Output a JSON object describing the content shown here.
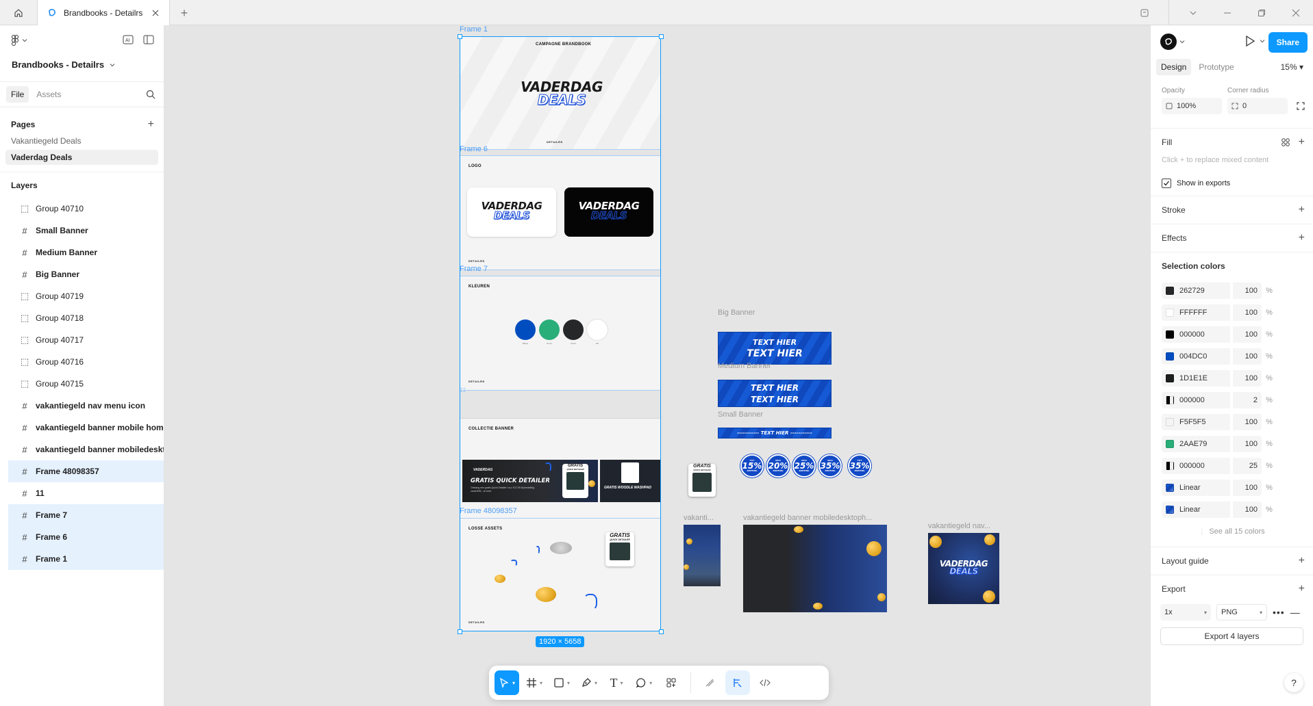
{
  "tabbar": {
    "tab_title": "Brandbooks - Detailrs",
    "new_tab_icon": "plus-icon"
  },
  "file": {
    "title": "Brandbooks - Detailrs"
  },
  "left_panel": {
    "tabs": [
      "File",
      "Assets"
    ],
    "pages_header": "Pages",
    "pages": [
      "Vakantiegeld Deals",
      "Vaderdag Deals"
    ],
    "layers_header": "Layers",
    "layers": [
      {
        "name": "Group 40710",
        "type": "group"
      },
      {
        "name": "Small Banner",
        "type": "frame"
      },
      {
        "name": "Medium Banner",
        "type": "frame"
      },
      {
        "name": "Big Banner",
        "type": "frame"
      },
      {
        "name": "Group 40719",
        "type": "group"
      },
      {
        "name": "Group 40718",
        "type": "group"
      },
      {
        "name": "Group 40717",
        "type": "group"
      },
      {
        "name": "Group 40716",
        "type": "group"
      },
      {
        "name": "Group 40715",
        "type": "group"
      },
      {
        "name": "vakantiegeld nav menu icon",
        "type": "frame"
      },
      {
        "name": "vakantiegeld banner mobile home",
        "type": "frame"
      },
      {
        "name": "vakantiegeld banner mobiledesktophome",
        "type": "frame"
      },
      {
        "name": "Frame 48098357",
        "type": "frame",
        "selected": true
      },
      {
        "name": "11",
        "type": "frame"
      },
      {
        "name": "Frame 7",
        "type": "frame",
        "selected": true
      },
      {
        "name": "Frame 6",
        "type": "frame",
        "selected": true
      },
      {
        "name": "Frame 1",
        "type": "frame",
        "selected": true
      }
    ]
  },
  "canvas": {
    "frame_labels": {
      "f1": "Frame 1",
      "f6": "Frame 6",
      "f7": "Frame 7",
      "f11": "11",
      "f48": "Frame 48098357"
    },
    "frames": {
      "campagne": "CAMPAGNE BRANDBOOK",
      "logo": "LOGO",
      "kleuren": "KLEUREN",
      "collectie": "COLLECTIE BANNER",
      "losse": "LOSSE ASSETS",
      "brand": "DETAILRS"
    },
    "wordmark": {
      "line1": "VADERDAG",
      "line2": "DEALS"
    },
    "colour_labels": [
      "Blauw",
      "Groen",
      "Zwart",
      "Wit"
    ],
    "collectie": {
      "small_tag": "VADERDAG",
      "headline": "GRATIS QUICK DETAILER",
      "body": "Ontvang een gratis Quick Detailer t.w.v. €17,99 bij bestelling vanaf €99,- of meer.",
      "headline2": "GRATIS WOODLE WASHPAD",
      "product_label": "GRATIS",
      "product_sub": "QUICK DETAILER"
    },
    "selection_size": "1920 × 5658",
    "banner_labels": {
      "big": "Big Banner",
      "medium": "Medium Banner",
      "small": "Small Banner"
    },
    "banner_text": {
      "big1": "TEXT HIER",
      "big2": "TEXT HIER",
      "med1": "TEXT HIER",
      "med2": "TEXT HIER",
      "small": "----------- TEXT HIER -----------"
    },
    "badges": [
      {
        "top": "TOT",
        "value": "15%",
        "bottom": "KORTING"
      },
      {
        "top": "MAX",
        "value": "20%",
        "bottom": "KORTING"
      },
      {
        "top": "MAX",
        "value": "25%",
        "bottom": "KORTING"
      },
      {
        "top": "MAX",
        "value": "35%",
        "bottom": "KORTING"
      },
      {
        "top": "TOT",
        "value": "35%",
        "bottom": "KORTING"
      }
    ],
    "vak_labels": {
      "mobile": "vakanti...",
      "desktop": "vakantiegeld banner mobiledesktoph...",
      "nav": "vakantiegeld nav..."
    }
  },
  "toolbar": {
    "tools": [
      {
        "icon": "move-cursor-icon",
        "active": true
      },
      {
        "icon": "frame-hash-icon"
      },
      {
        "icon": "rectangle-icon"
      },
      {
        "icon": "pen-icon"
      },
      {
        "icon": "text-icon",
        "label": "T"
      },
      {
        "icon": "comment-icon"
      },
      {
        "icon": "actions-icon"
      },
      {
        "icon": "draw-icon"
      },
      {
        "icon": "design-mode-icon"
      },
      {
        "icon": "dev-mode-icon"
      }
    ]
  },
  "right_panel": {
    "share_label": "Share",
    "tabs": [
      "Design",
      "Prototype"
    ],
    "zoom": "15%",
    "opacity_label": "Opacity",
    "opacity_value": "100%",
    "radius_label": "Corner radius",
    "radius_value": "0",
    "fill_header": "Fill",
    "fill_hint": "Click + to replace mixed content",
    "show_in_exports": "Show in exports",
    "stroke_header": "Stroke",
    "effects_header": "Effects",
    "selection_colors_header": "Selection colors",
    "colors": [
      {
        "hex": "262729",
        "swatch": "#262729",
        "opacity": "100"
      },
      {
        "hex": "FFFFFF",
        "swatch": "#FFFFFF",
        "opacity": "100"
      },
      {
        "hex": "000000",
        "swatch": "#000000",
        "opacity": "100"
      },
      {
        "hex": "004DC0",
        "swatch": "#004DC0",
        "opacity": "100"
      },
      {
        "hex": "1D1E1E",
        "swatch": "#1D1E1E",
        "opacity": "100"
      },
      {
        "hex": "000000",
        "swatch": "#000000",
        "opacity": "2",
        "partial": true
      },
      {
        "hex": "F5F5F5",
        "swatch": "#F5F5F5",
        "opacity": "100"
      },
      {
        "hex": "2AAE79",
        "swatch": "#2AAE79",
        "opacity": "100"
      },
      {
        "hex": "000000",
        "swatch": "#000000",
        "opacity": "25",
        "partial": true
      },
      {
        "hex": "Linear",
        "swatch": "linear",
        "opacity": "100"
      },
      {
        "hex": "Linear",
        "swatch": "linear",
        "opacity": "100"
      }
    ],
    "percent_sign": "%",
    "see_all": "See all 15 colors",
    "layout_guide_header": "Layout guide",
    "export_header": "Export",
    "export_scale": "1x",
    "export_format": "PNG",
    "export_button": "Export 4 layers",
    "help": "?"
  },
  "colors": {
    "accent": "#0d99ff",
    "blue": "#004DC0",
    "green": "#2AAE79",
    "dark": "#262729"
  }
}
